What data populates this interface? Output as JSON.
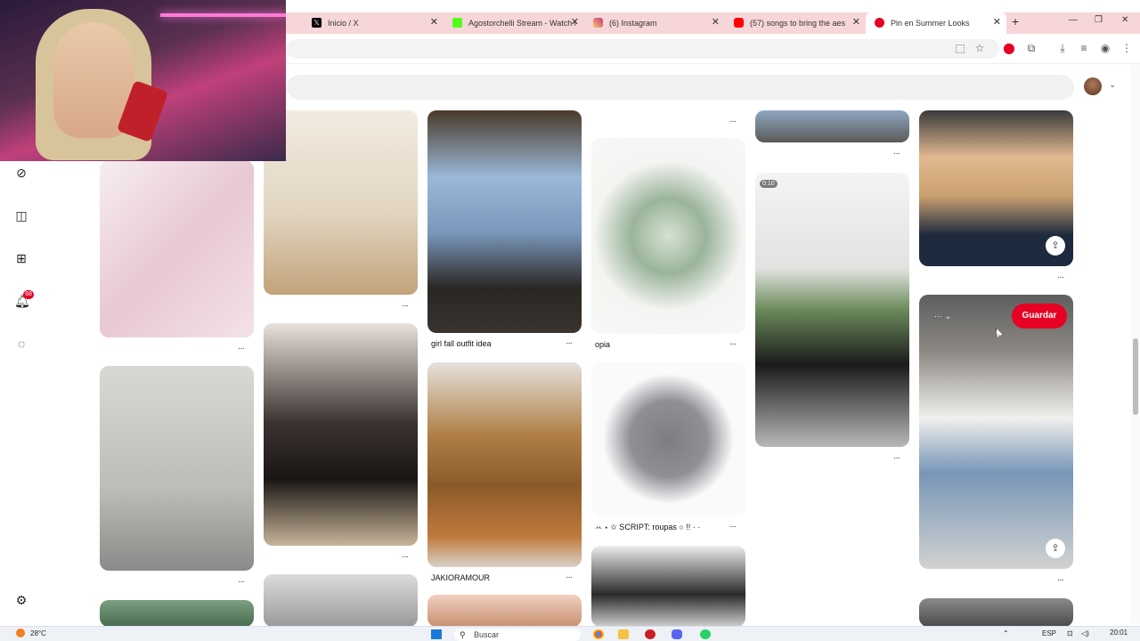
{
  "browser": {
    "tabs": [
      {
        "label": "Inicio / X",
        "icon": "x-logo-icon",
        "color": "#000000"
      },
      {
        "label": "Agostorchelli Stream - Watch l",
        "icon": "kick-logo-icon",
        "color": "#53fc18"
      },
      {
        "label": "(6) Instagram",
        "icon": "instagram-logo-icon",
        "color": "#c13584"
      },
      {
        "label": "(57) songs to bring the aes",
        "icon": "youtube-logo-icon",
        "color": "#ff0000"
      },
      {
        "label": "Pin en Summer Looks",
        "icon": "pinterest-logo-icon",
        "color": "#e60023"
      }
    ],
    "active_tab": "Pin en Summer Looks"
  },
  "pins": {
    "captions": {
      "girl_fall": "girl fall outfit idea",
      "opia": "opia",
      "script": "ꕀ ⋆ ✩ SCRIPT: roupas ○ !! · ·",
      "jakio": "JAKIORAMOUR"
    },
    "video_time": "0:10",
    "save_label": "Guardar",
    "more_label": "···",
    "notification_count": "68"
  },
  "taskbar": {
    "weather": "28°C",
    "search_placeholder": "Buscar",
    "lang": "ESP",
    "time": "20:01"
  },
  "colors": {
    "accent": "#e60023",
    "tabbar": "#f6d6d8"
  }
}
